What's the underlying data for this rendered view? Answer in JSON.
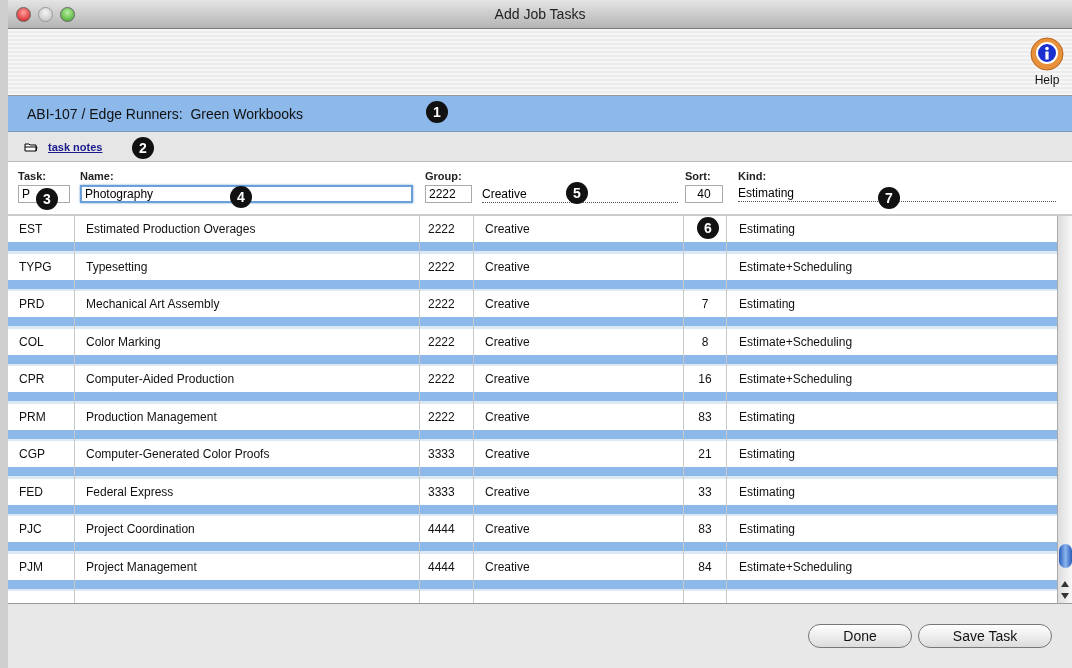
{
  "window": {
    "title": "Add Job Tasks"
  },
  "toolbar": {
    "help_label": "Help"
  },
  "header": {
    "title": "ABI-107 / Edge Runners:  Green Workbooks"
  },
  "notes_link": "task notes",
  "form": {
    "task_label": "Task:",
    "task_value": "P",
    "name_label": "Name:",
    "name_value": "Photography",
    "group_label": "Group:",
    "group_value": "2222",
    "group_name": "Creative",
    "sort_label": "Sort:",
    "sort_value": "40",
    "kind_label": "Kind:",
    "kind_value": "Estimating"
  },
  "table": {
    "rows": [
      {
        "task": "EST",
        "name": "Estimated Production Overages",
        "group": "2222",
        "group_name": "Creative",
        "sort": "",
        "kind": "Estimating"
      },
      {
        "task": "TYPG",
        "name": "Typesetting",
        "group": "2222",
        "group_name": "Creative",
        "sort": "",
        "kind": "Estimate+Scheduling"
      },
      {
        "task": "PRD",
        "name": "Mechanical Art Assembly",
        "group": "2222",
        "group_name": "Creative",
        "sort": "7",
        "kind": "Estimating"
      },
      {
        "task": "COL",
        "name": "Color Marking",
        "group": "2222",
        "group_name": "Creative",
        "sort": "8",
        "kind": "Estimate+Scheduling"
      },
      {
        "task": "CPR",
        "name": "Computer-Aided Production",
        "group": "2222",
        "group_name": "Creative",
        "sort": "16",
        "kind": "Estimate+Scheduling"
      },
      {
        "task": "PRM",
        "name": "Production Management",
        "group": "2222",
        "group_name": "Creative",
        "sort": "83",
        "kind": "Estimating"
      },
      {
        "task": "CGP",
        "name": "Computer-Generated Color Proofs",
        "group": "3333",
        "group_name": "Creative",
        "sort": "21",
        "kind": "Estimating"
      },
      {
        "task": "FED",
        "name": "Federal Express",
        "group": "3333",
        "group_name": "Creative",
        "sort": "33",
        "kind": "Estimating"
      },
      {
        "task": "PJC",
        "name": "Project Coordination",
        "group": "4444",
        "group_name": "Creative",
        "sort": "83",
        "kind": "Estimating"
      },
      {
        "task": "PJM",
        "name": "Project Management",
        "group": "4444",
        "group_name": "Creative",
        "sort": "84",
        "kind": "Estimate+Scheduling"
      }
    ]
  },
  "buttons": [
    "Done",
    "Save Task"
  ],
  "callouts": [
    "1",
    "2",
    "3",
    "4",
    "5",
    "6",
    "7"
  ]
}
